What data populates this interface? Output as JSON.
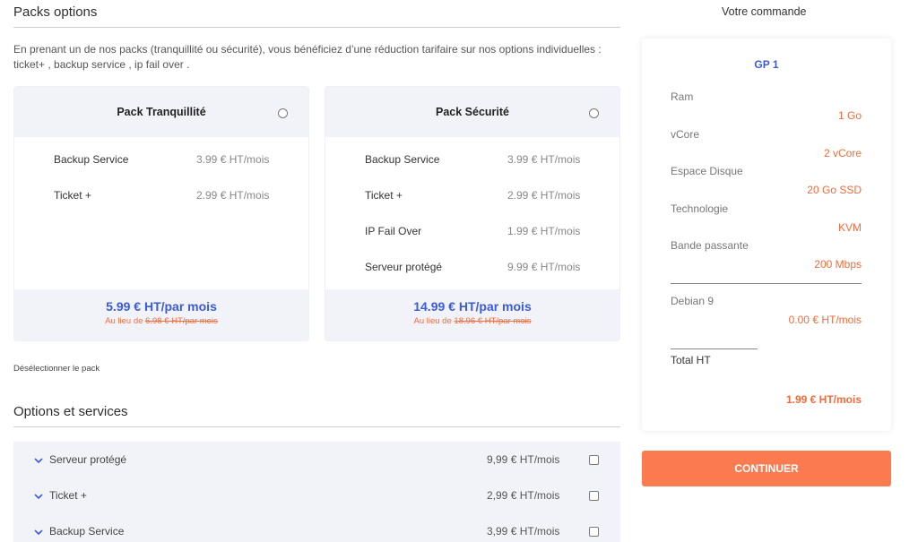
{
  "packs_section": {
    "title": "Packs options",
    "intro": "En prenant un de nos packs (tranquillité ou sécurité), vous bénéficiez d’une réduction tarifaire sur nos options individuelles : ticket+ , backup service , ip fail over .",
    "packs": [
      {
        "title": "Pack Tranquillité",
        "items": [
          {
            "name": "Backup Service",
            "price": "3.99 € HT/mois"
          },
          {
            "name": "Ticket +",
            "price": "2.99 € HT/mois"
          }
        ],
        "price": "5.99 € HT/par mois",
        "old_prefix": "Au lieu de ",
        "old_price": "6.98 € HT/par mois"
      },
      {
        "title": "Pack Sécurité",
        "items": [
          {
            "name": "Backup Service",
            "price": "3.99 € HT/mois"
          },
          {
            "name": "Ticket +",
            "price": "2.99 € HT/mois"
          },
          {
            "name": "IP Fail Over",
            "price": "1.99 € HT/mois"
          },
          {
            "name": "Serveur protégé",
            "price": "9.99 € HT/mois"
          }
        ],
        "price": "14.99 € HT/par mois",
        "old_prefix": "Au lieu de ",
        "old_price": "18.96 € HT/par mois"
      }
    ],
    "deselect_label": "Désélectionner le pack"
  },
  "options_section": {
    "title": "Options et services",
    "items": [
      {
        "name": "Serveur protégé",
        "price": "9,99 € HT/mois",
        "icon": "chevron-down-icon"
      },
      {
        "name": "Ticket +",
        "price": "2,99 € HT/mois",
        "icon": "chevron-down-icon"
      },
      {
        "name": "Backup Service",
        "price": "3,99 € HT/mois",
        "icon": "chevron-down-icon"
      }
    ]
  },
  "order": {
    "title": "Votre commande",
    "product": "GP 1",
    "specs": [
      {
        "label": "Ram",
        "value": "1 Go"
      },
      {
        "label": "vCore",
        "value": "2 vCore"
      },
      {
        "label": "Espace Disque",
        "value": "20 Go SSD"
      },
      {
        "label": "Technologie",
        "value": "KVM"
      },
      {
        "label": "Bande passante",
        "value": "200 Mbps"
      }
    ],
    "os": {
      "label": "Debian 9",
      "value": "0.00 € HT/mois"
    },
    "total_label": "Total HT",
    "total_value": "1.99 € HT/mois",
    "continue_label": "CONTINUER"
  },
  "colors": {
    "accent_blue": "#3b5bdb",
    "accent_orange": "#f26b3a",
    "button_orange": "#f97b4f",
    "panel_bg": "#f1f3f8"
  }
}
